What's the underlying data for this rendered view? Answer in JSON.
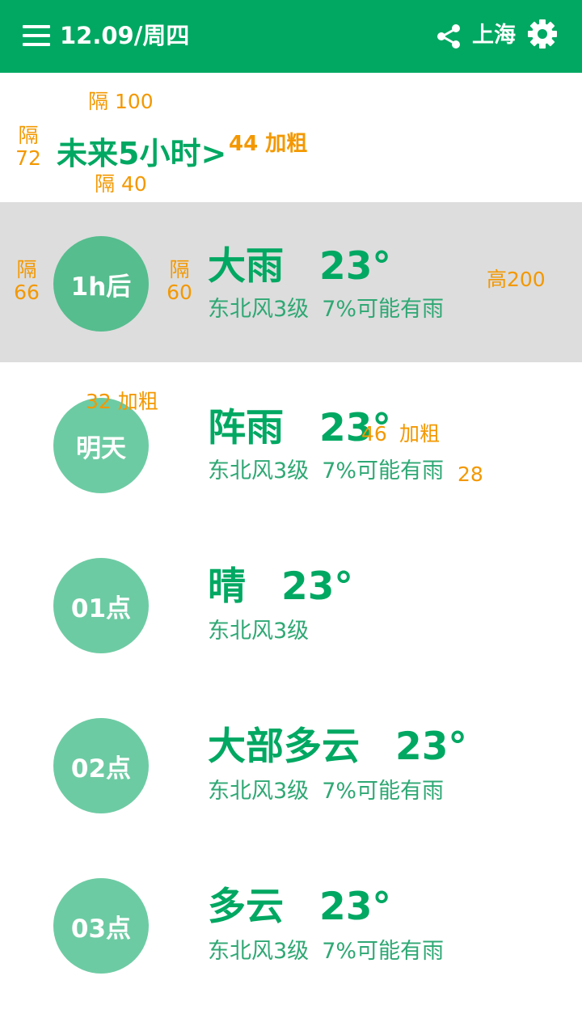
{
  "header": {
    "date": "12.09/周四",
    "city": "上海",
    "menu_icon": "hamburger-menu-icon",
    "share_icon": "share-icon",
    "settings_icon": "gear-icon",
    "colors": {
      "header_bg": "#00A862",
      "text": "#FFFFFF"
    }
  },
  "section": {
    "title": "未来5小时>"
  },
  "annotations": {
    "gap100": "隔 100",
    "gap72_a": "隔",
    "gap72_b": "72",
    "title_font": "44 加粗",
    "gap40": "隔 40",
    "gap66_a": "隔",
    "gap66_b": "66",
    "gap60_a": "隔",
    "gap60_b": "60",
    "height200": "高200",
    "circle_font": "32 加粗",
    "cond_font": "46",
    "cond_bold": "加粗",
    "detail_font": "28",
    "color": "#F39800"
  },
  "forecast": [
    {
      "time": "1h后",
      "condition": "大雨",
      "temp": "23°",
      "wind": "东北风3级",
      "rain": "7%可能有雨",
      "highlighted": true
    },
    {
      "time": "明天",
      "condition": "阵雨",
      "temp": "23°",
      "wind": "东北风3级",
      "rain": "7%可能有雨",
      "highlighted": false
    },
    {
      "time": "01点",
      "condition": "晴",
      "temp": "23°",
      "wind": "东北风3级",
      "rain": "",
      "highlighted": false
    },
    {
      "time": "02点",
      "condition": "大部多云",
      "temp": "23°",
      "wind": "东北风3级",
      "rain": "7%可能有雨",
      "highlighted": false
    },
    {
      "time": "03点",
      "condition": "多云",
      "temp": "23°",
      "wind": "东北风3级",
      "rain": "7%可能有雨",
      "highlighted": false
    }
  ],
  "colors": {
    "primary": "#00A862",
    "circle": "#6DCBA3",
    "circle_active": "#56BD8E",
    "row_active_bg": "#DDDDDD"
  }
}
